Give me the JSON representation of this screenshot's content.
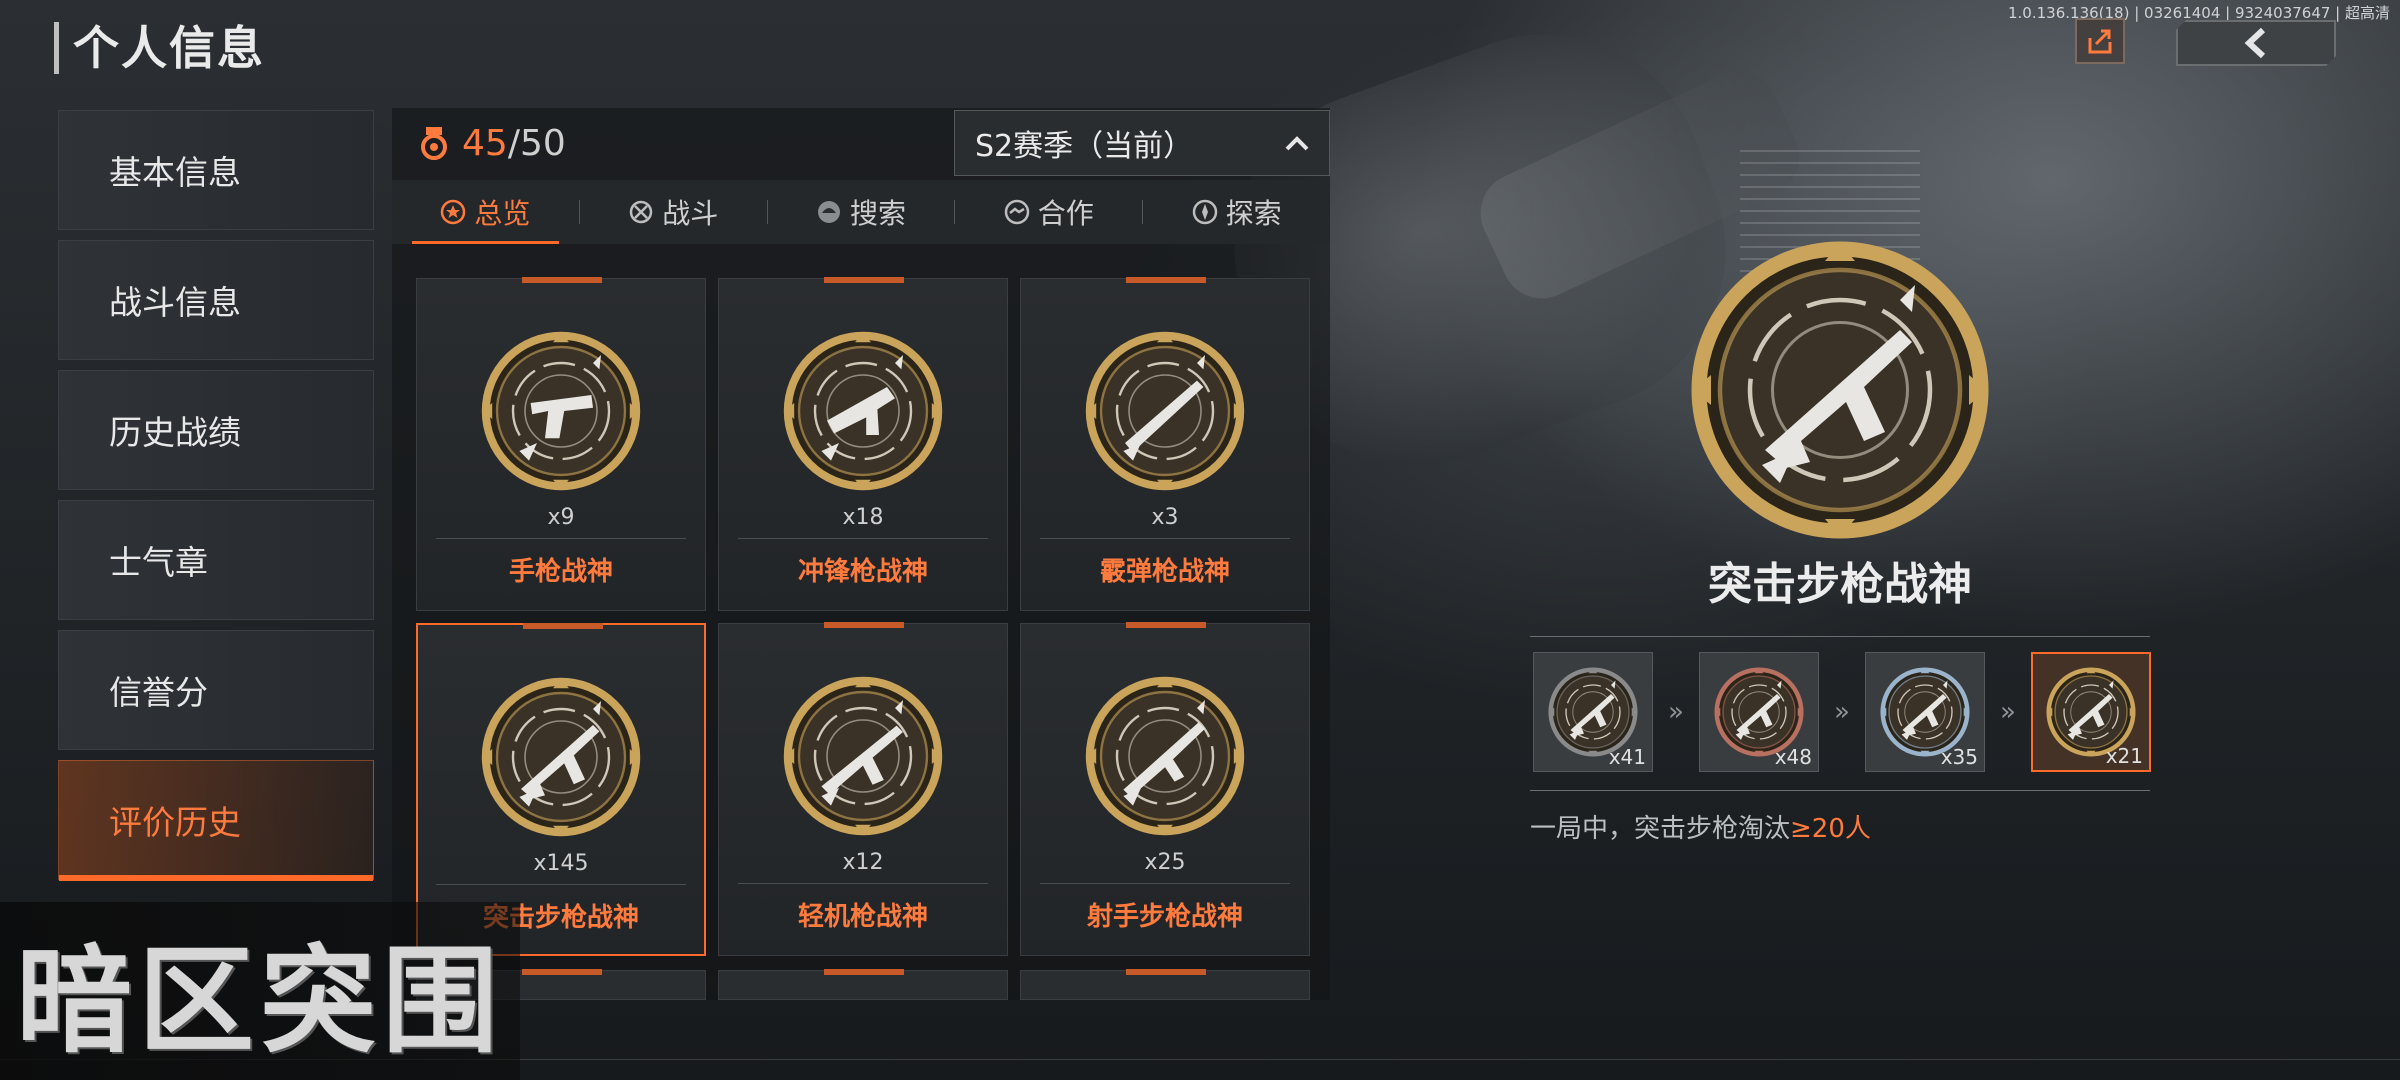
{
  "page_title": "个人信息",
  "build_info": "1.0.136.136(18) | 03261404 | 9324037647 | 超高清",
  "sidebar": {
    "items": [
      {
        "label": "基本信息"
      },
      {
        "label": "战斗信息"
      },
      {
        "label": "历史战绩"
      },
      {
        "label": "士气章"
      },
      {
        "label": "信誉分"
      },
      {
        "label": "评价历史",
        "active": true
      }
    ]
  },
  "progress": {
    "current": "45",
    "total": "/50"
  },
  "season": {
    "label": "S2赛季（当前）"
  },
  "tabs": [
    {
      "label": "总览",
      "icon": "star-icon",
      "active": true
    },
    {
      "label": "战斗",
      "icon": "crosshair-icon"
    },
    {
      "label": "搜索",
      "icon": "helmet-icon"
    },
    {
      "label": "合作",
      "icon": "handshake-icon"
    },
    {
      "label": "探索",
      "icon": "compass-icon"
    }
  ],
  "achievements": [
    {
      "name": "手枪战神",
      "count": "x9",
      "weapon": "pistol"
    },
    {
      "name": "冲锋枪战神",
      "count": "x18",
      "weapon": "smg"
    },
    {
      "name": "霰弹枪战神",
      "count": "x3",
      "weapon": "shotgun"
    },
    {
      "name": "突击步枪战神",
      "count": "x145",
      "weapon": "rifle",
      "selected": true
    },
    {
      "name": "轻机枪战神",
      "count": "x12",
      "weapon": "lmg"
    },
    {
      "name": "射手步枪战神",
      "count": "x25",
      "weapon": "dmr"
    }
  ],
  "detail": {
    "name": "突击步枪战神",
    "tiers": [
      {
        "count": "x41",
        "color": "#8a8a8a"
      },
      {
        "count": "x48",
        "color": "#b87060"
      },
      {
        "count": "x35",
        "color": "#9ab4cc"
      },
      {
        "count": "x21",
        "color": "#c9a45a",
        "current": true
      }
    ],
    "condition_prefix": "一局中，突击步枪淘汰",
    "condition_value": "≥20人"
  },
  "logo_text": "暗区突围",
  "colors": {
    "accent": "#ff6a2a",
    "gold": "#c9a45a"
  }
}
